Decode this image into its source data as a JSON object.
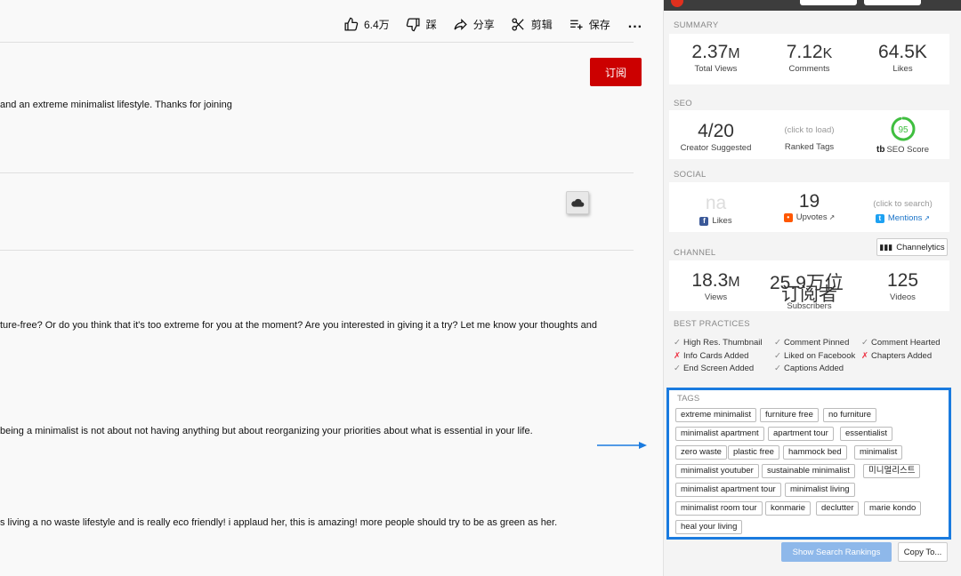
{
  "actions": {
    "like_count": "6.4万",
    "dislike_label": "踩",
    "share_label": "分享",
    "clip_label": "剪辑",
    "save_label": "保存",
    "more_label": "..."
  },
  "subscribe_label": "订阅",
  "lines": {
    "l1": "and an extreme minimalist lifestyle. Thanks for joining",
    "l2": "ture-free? Or do you think that it's too extreme for you at the moment? Are you interested in giving it a try? Let me know your thoughts and",
    "l3": "being a minimalist is not about not having anything but about reorganizing your priorities about what is essential in your life.",
    "l4": "s living a no waste lifestyle and is really eco friendly! i applaud her, this is amazing! more people should try to be as green as her."
  },
  "summary": {
    "label": "SUMMARY",
    "views": {
      "value": "2.37",
      "unit": "M",
      "caption": "Total Views"
    },
    "comments": {
      "value": "7.12",
      "unit": "K",
      "caption": "Comments"
    },
    "likes": {
      "value": "64.5K",
      "caption": "Likes"
    }
  },
  "seo": {
    "label": "SEO",
    "creator": {
      "value": "4/20",
      "caption": "Creator Suggested"
    },
    "ranked": {
      "value": "(click to load)",
      "caption": "Ranked Tags"
    },
    "score": {
      "value": "95",
      "score_pct": 95,
      "caption": "SEO Score",
      "brand": "tb"
    }
  },
  "social": {
    "label": "SOCIAL",
    "likes": {
      "value": "na",
      "caption": "Likes"
    },
    "upvotes": {
      "value": "19",
      "caption": "Upvotes"
    },
    "mentions": {
      "value": "(click to search)",
      "caption": "Mentions"
    }
  },
  "channel": {
    "label": "CHANNEL",
    "channelytics_label": "Channelytics",
    "views": {
      "value": "18.3",
      "unit": "M",
      "caption": "Views"
    },
    "subscribers": {
      "value": "25.9万位",
      "value2": "订阅者",
      "caption": "Subscribers"
    },
    "videos": {
      "value": "125",
      "caption": "Videos"
    }
  },
  "best_practices": {
    "label": "BEST PRACTICES",
    "items": [
      {
        "text": "High Res. Thumbnail",
        "ok": true,
        "mark": "✓"
      },
      {
        "text": "Comment Pinned",
        "ok": true,
        "mark": "✓"
      },
      {
        "text": "Comment Hearted",
        "ok": true,
        "mark": "✓"
      },
      {
        "text": "Info Cards Added",
        "ok": false,
        "mark": "✗"
      },
      {
        "text": "Liked on Facebook",
        "ok": true,
        "mark": "✓"
      },
      {
        "text": "Chapters Added",
        "ok": false,
        "mark": "✗"
      },
      {
        "text": "End Screen Added",
        "ok": true,
        "mark": "✓"
      },
      {
        "text": "Captions Added",
        "ok": true,
        "mark": "✓"
      }
    ]
  },
  "tags": {
    "label": "TAGS",
    "items": [
      "extreme minimalist",
      "furniture free",
      "no furniture",
      "minimalist apartment",
      "apartment tour",
      "essentialist",
      "zero waste",
      "plastic free",
      "hammock bed",
      "minimalist",
      "minimalist youtuber",
      "sustainable minimalist",
      "미니멀리스트",
      "minimalist apartment tour",
      "minimalist living",
      "minimalist room tour",
      "konmarie",
      "declutter",
      "marie kondo",
      "heal your living"
    ]
  },
  "buttons": {
    "rankings": "Show Search Rankings",
    "copy": "Copy To..."
  },
  "colors": {
    "subscribe": "#cc0000",
    "tags_highlight": "#1a7bdf",
    "seo_ring": "#3fbf3f",
    "facebook": "#3b5998",
    "reddit": "#ff5700",
    "twitter": "#1da1f2"
  }
}
